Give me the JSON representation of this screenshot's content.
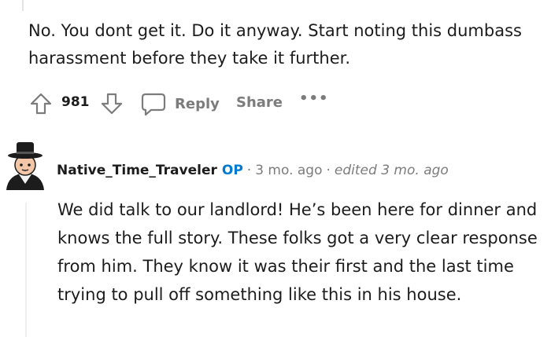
{
  "parent_comment": {
    "body": "No. You dont get it. Do it anyway. Start noting this dumbass harassment before they take it further.",
    "score": "981",
    "reply_label": "Reply",
    "share_label": "Share",
    "more_label": "•••"
  },
  "reply_comment": {
    "author": "Native_Time_Traveler",
    "op_badge": "OP",
    "separator": "·",
    "time": "3 mo. ago",
    "edited": "edited 3 mo. ago",
    "body": "We did talk to our landlord! He’s been here for dinner and knows the full story. These folks got a very clear response from him. They know it was their first and the last time trying to pull off something like this in his house."
  },
  "colors": {
    "text": "#1c1c1c",
    "muted": "#7c7c7c",
    "op_accent": "#0079d3",
    "thread_line": "#edeff1"
  },
  "icons": [
    "upvote-icon",
    "downvote-icon",
    "comment-icon",
    "more-icon",
    "avatar"
  ]
}
